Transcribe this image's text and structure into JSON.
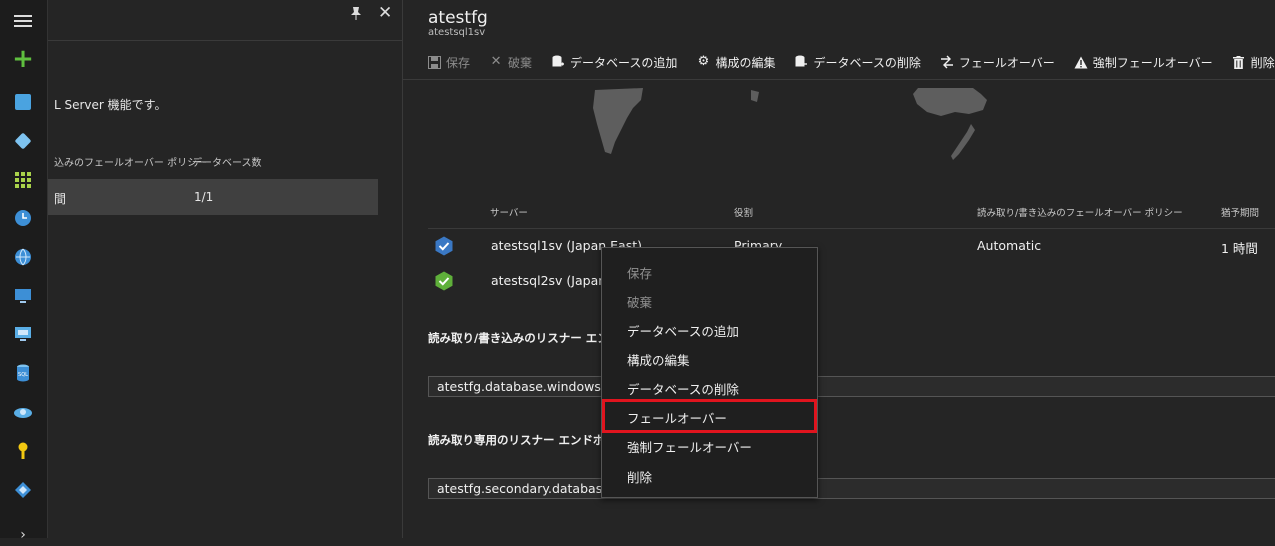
{
  "blade1": {
    "description": "L Server 機能です。",
    "col_failover_policy": "込みのフェールオーバー ポリシー",
    "col_db_count": "データベース数",
    "row_policy": "間",
    "row_db_count": "1/1"
  },
  "blade2": {
    "title": "atestfg",
    "subtitle": "atestsql1sv"
  },
  "toolbar": {
    "save": "保存",
    "discard": "破棄",
    "add_db": "データベースの追加",
    "edit_config": "構成の編集",
    "remove_db": "データベースの削除",
    "failover": "フェールオーバー",
    "forced_failover": "強制フェールオーバー",
    "delete": "削除"
  },
  "servers_table": {
    "headers": [
      "サーバー",
      "役割",
      "読み取り/書き込みのフェールオーバー ポリシー",
      "猶予期間"
    ],
    "rows": [
      {
        "server": "atestsql1sv (Japan East)",
        "role": "Primary",
        "policy": "Automatic",
        "grace": "1 時間"
      },
      {
        "server": "atestsql2sv (Japan",
        "role": "",
        "policy": "",
        "grace": ""
      }
    ]
  },
  "listener": {
    "rw_label": "読み取り/書き込みのリスナー エンドポ",
    "rw_value": "atestfg.database.windows.ne",
    "ro_label": "読み取り専用のリスナー エンドポイント",
    "ro_value": "atestfg.secondary.database.w"
  },
  "context_menu": {
    "items": [
      "保存",
      "破棄",
      "データベースの追加",
      "構成の編集",
      "データベースの削除",
      "フェールオーバー",
      "強制フェールオーバー",
      "削除"
    ],
    "highlighted": "フェールオーバー"
  },
  "colors": {
    "background": "#252525",
    "primary_badge": "#3a78c4",
    "secondary_badge": "#5fb03a",
    "highlight": "#e0141e"
  }
}
